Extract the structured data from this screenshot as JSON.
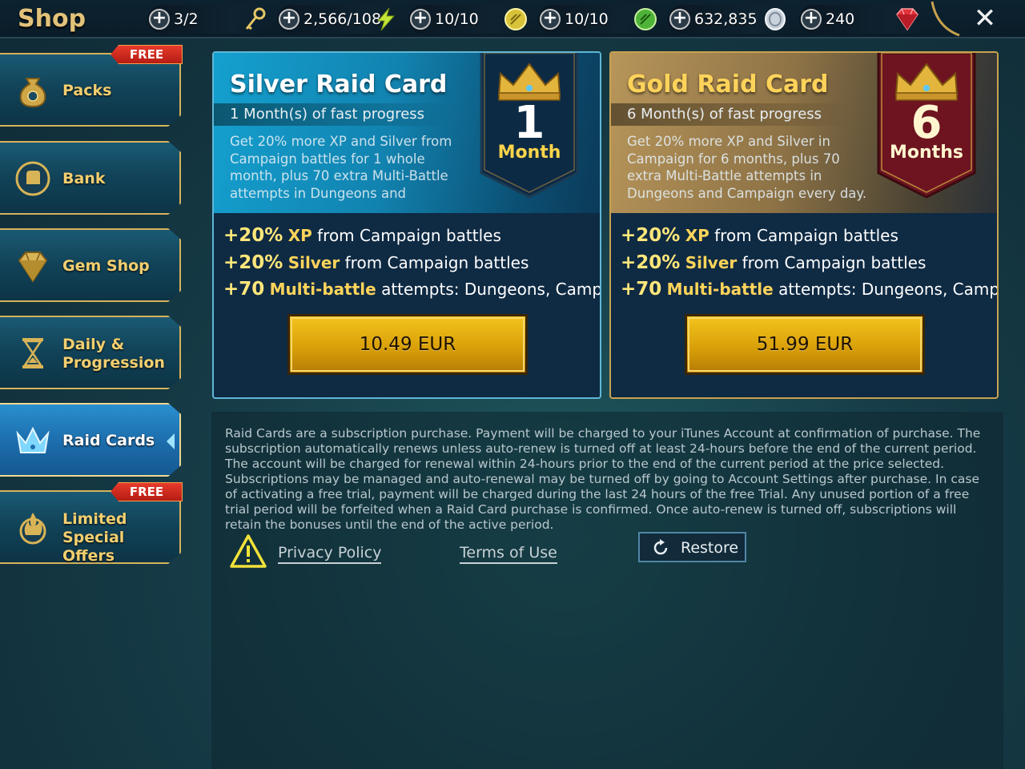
{
  "header": {
    "title": "Shop",
    "resources": [
      {
        "value": "3/2",
        "icon": "key-icon"
      },
      {
        "value": "2,566/108",
        "icon": "energy-icon"
      },
      {
        "value": "10/10",
        "icon": "gold-arena-token-icon"
      },
      {
        "value": "10/10",
        "icon": "green-token-icon"
      },
      {
        "value": "632,835",
        "icon": "silver-coin-icon"
      },
      {
        "value": "240",
        "icon": "ruby-gem-icon"
      }
    ],
    "plus_label": "+",
    "close_label": "✕"
  },
  "sidebar": {
    "items": [
      {
        "label": "Packs",
        "badge": "FREE",
        "icon": "money-bag-icon"
      },
      {
        "label": "Bank",
        "icon": "bank-fist-icon"
      },
      {
        "label": "Gem Shop",
        "icon": "gem-icon"
      },
      {
        "label_line1": "Daily &",
        "label_line2": "Progression",
        "icon": "hourglass-icon"
      },
      {
        "label": "Raid Cards",
        "icon": "crown-icon",
        "active": true
      },
      {
        "label_line1": "Limited Special",
        "label_line2": "Offers",
        "badge": "FREE",
        "icon": "flame-coin-icon"
      }
    ]
  },
  "cards": [
    {
      "title": "Silver Raid Card",
      "subtitle": "1 Month(s) of fast progress",
      "description": "Get 20% more XP and Silver from Campaign battles for 1 whole month, plus 70 extra Multi-Battle attempts in Dungeons and",
      "banner_number": "1",
      "banner_word": "Month",
      "benefits": [
        {
          "num": "+20%",
          "kw": "XP",
          "rest": "from Campaign battles"
        },
        {
          "num": "+20%",
          "kw": "Silver",
          "rest": "from Campaign battles"
        },
        {
          "num": "+70",
          "kw": "Multi-battle",
          "rest": "attempts: Dungeons, Campaign"
        }
      ],
      "price": "10.49 EUR"
    },
    {
      "title": "Gold Raid Card",
      "subtitle": "6 Month(s) of fast progress",
      "description": "Get 20% more XP and Silver in Campaign for 6 months, plus 70 extra Multi-Battle attempts in Dungeons and Campaign every day.",
      "banner_number": "6",
      "banner_word": "Months",
      "benefits": [
        {
          "num": "+20%",
          "kw": "XP",
          "rest": "from Campaign battles"
        },
        {
          "num": "+20%",
          "kw": "Silver",
          "rest": "from Campaign battles"
        },
        {
          "num": "+70",
          "kw": "Multi-battle",
          "rest": "attempts: Dungeons, Campaign"
        }
      ],
      "price": "51.99 EUR"
    }
  ],
  "legal": {
    "text": "Raid Cards are a subscription purchase. Payment will be charged to your iTunes Account at confirmation of purchase. The subscription automatically renews unless auto-renew is turned off at least 24-hours before the end of the current period. The account will be charged for renewal within 24-hours prior to the end of the current period at the price selected. Subscriptions may be managed and auto-renewal may be turned off by going to Account Settings after purchase. In case of activating a free trial, payment will be charged during the last 24 hours of the free Trial. Any unused portion of a free trial period will be forfeited when a Raid Card purchase is confirmed. Once auto-renew is turned off, subscriptions will retain the bonuses until the end of the active period.",
    "privacy_label": "Privacy Policy",
    "terms_label": "Terms of Use",
    "restore_label": "Restore"
  },
  "colors": {
    "accent_gold": "#f3cf70",
    "active_tab": "#2a8fd0",
    "buy_button": "#f4c41d",
    "free_badge": "#e73b2c"
  }
}
